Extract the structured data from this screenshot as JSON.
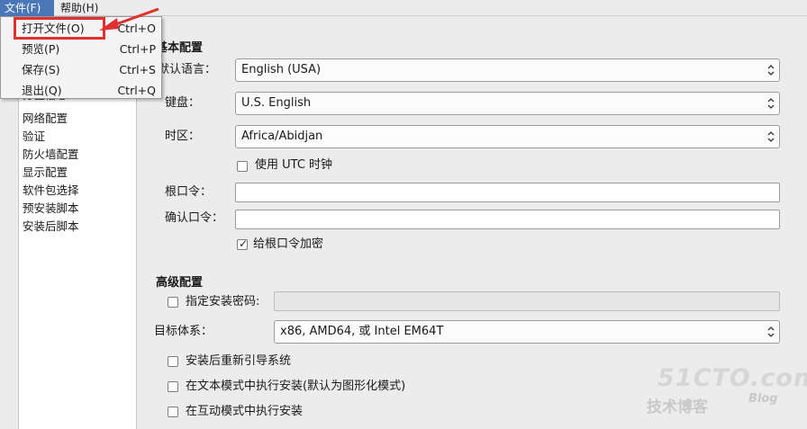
{
  "menubar": {
    "file_label": "文件(F)",
    "help_label": "帮助(H)"
  },
  "file_menu": {
    "items": [
      {
        "label": "打开文件(O)",
        "accel": "Ctrl+O"
      },
      {
        "label": "预览(P)",
        "accel": "Ctrl+P"
      },
      {
        "label": "保存(S)",
        "accel": "Ctrl+S"
      },
      {
        "label": "退出(Q)",
        "accel": "Ctrl+Q"
      }
    ]
  },
  "sidebar": {
    "partial_item": "分区信息",
    "items": [
      "网络配置",
      "验证",
      "防火墙配置",
      "显示配置",
      "软件包选择",
      "预安装脚本",
      "安装后脚本"
    ]
  },
  "basic": {
    "title": "基本配置",
    "language_label": "默认语言：",
    "language_value": "English (USA)",
    "keyboard_label": "键盘：",
    "keyboard_value": "U.S. English",
    "timezone_label": "时区：",
    "timezone_value": "Africa/Abidjan",
    "utc_label": "使用 UTC 时钟",
    "utc_checked": false,
    "root_pw_label": "根口令：",
    "root_pw_value": "",
    "confirm_pw_label": "确认口令：",
    "confirm_pw_value": "",
    "encrypt_label": "给根口令加密",
    "encrypt_checked": true
  },
  "advanced": {
    "title": "高级配置",
    "install_pw_label": "指定安装密码:",
    "install_pw_checked": false,
    "arch_label": "目标体系：",
    "arch_value": "x86, AMD64, 或 Intel EM64T",
    "reboot_label": "安装后重新引导系统",
    "reboot_checked": false,
    "text_mode_label": "在文本模式中执行安装(默认为图形化模式)",
    "text_mode_checked": false,
    "interactive_label": "在互动模式中执行安装",
    "interactive_checked": false
  },
  "watermark": {
    "main": "51CTO.com",
    "sub": "技术博客",
    "blog": "Blog"
  },
  "colors": {
    "menu_active": "#4a77b8",
    "highlight_box": "#e03030"
  }
}
